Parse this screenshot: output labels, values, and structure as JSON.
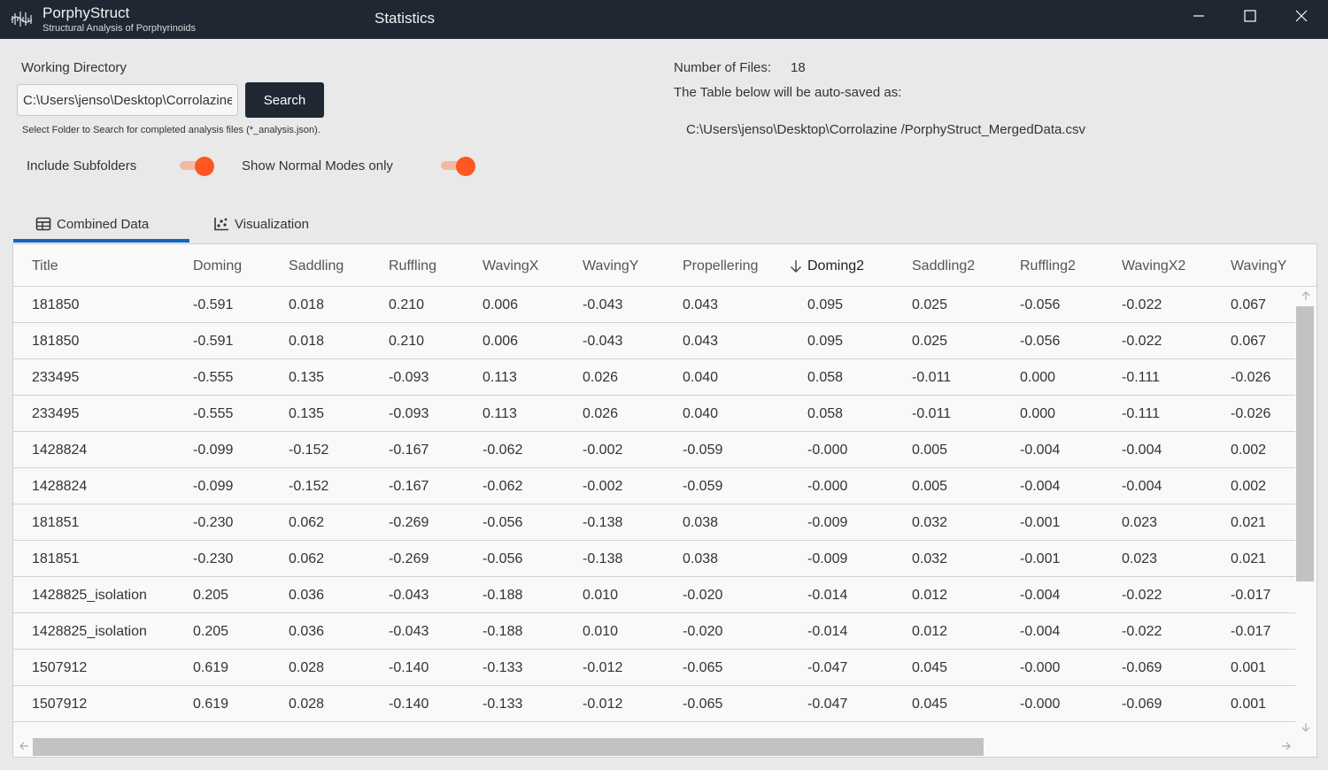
{
  "window": {
    "app_name": "PorphyStruct",
    "app_subtitle": "Structural Analysis of Porphyrinoids",
    "title": "Statistics"
  },
  "working_directory": {
    "label": "Working Directory",
    "value": "C:\\Users\\jenso\\Desktop\\Corrolazine",
    "search_label": "Search",
    "hint": "Select Folder to Search for completed analysis files (*_analysis.json)."
  },
  "info": {
    "files_label": "Number of Files:",
    "files_count": "18",
    "autosave_label": "The Table below will be auto-saved as:",
    "autosave_path": "C:\\Users\\jenso\\Desktop\\Corrolazine /PorphyStruct_MergedData.csv"
  },
  "options": {
    "include_subfolders_label": "Include Subfolders",
    "include_subfolders": true,
    "normal_modes_label": "Show Normal Modes only",
    "normal_modes": true
  },
  "tabs": [
    {
      "label": "Combined Data",
      "icon": "table-icon",
      "selected": true
    },
    {
      "label": "Visualization",
      "icon": "scatter-chart-icon",
      "selected": false
    }
  ],
  "table": {
    "sorted_column": "Doming2",
    "columns": [
      "Title",
      "Doming",
      "Saddling",
      "Ruffling",
      "WavingX",
      "WavingY",
      "Propellering",
      "Doming2",
      "Saddling2",
      "Ruffling2",
      "WavingX2",
      "WavingY"
    ],
    "rows": [
      [
        "181850",
        "-0.591",
        "0.018",
        "0.210",
        "0.006",
        "-0.043",
        "0.043",
        "0.095",
        "0.025",
        "-0.056",
        "-0.022",
        "0.067"
      ],
      [
        "181850",
        "-0.591",
        "0.018",
        "0.210",
        "0.006",
        "-0.043",
        "0.043",
        "0.095",
        "0.025",
        "-0.056",
        "-0.022",
        "0.067"
      ],
      [
        "233495",
        "-0.555",
        "0.135",
        "-0.093",
        "0.113",
        "0.026",
        "0.040",
        "0.058",
        "-0.011",
        "0.000",
        "-0.111",
        "-0.026"
      ],
      [
        "233495",
        "-0.555",
        "0.135",
        "-0.093",
        "0.113",
        "0.026",
        "0.040",
        "0.058",
        "-0.011",
        "0.000",
        "-0.111",
        "-0.026"
      ],
      [
        "1428824",
        "-0.099",
        "-0.152",
        "-0.167",
        "-0.062",
        "-0.002",
        "-0.059",
        "-0.000",
        "0.005",
        "-0.004",
        "-0.004",
        "0.002"
      ],
      [
        "1428824",
        "-0.099",
        "-0.152",
        "-0.167",
        "-0.062",
        "-0.002",
        "-0.059",
        "-0.000",
        "0.005",
        "-0.004",
        "-0.004",
        "0.002"
      ],
      [
        "181851",
        "-0.230",
        "0.062",
        "-0.269",
        "-0.056",
        "-0.138",
        "0.038",
        "-0.009",
        "0.032",
        "-0.001",
        "0.023",
        "0.021"
      ],
      [
        "181851",
        "-0.230",
        "0.062",
        "-0.269",
        "-0.056",
        "-0.138",
        "0.038",
        "-0.009",
        "0.032",
        "-0.001",
        "0.023",
        "0.021"
      ],
      [
        "1428825_isolation",
        "0.205",
        "0.036",
        "-0.043",
        "-0.188",
        "0.010",
        "-0.020",
        "-0.014",
        "0.012",
        "-0.004",
        "-0.022",
        "-0.017"
      ],
      [
        "1428825_isolation",
        "0.205",
        "0.036",
        "-0.043",
        "-0.188",
        "0.010",
        "-0.020",
        "-0.014",
        "0.012",
        "-0.004",
        "-0.022",
        "-0.017"
      ],
      [
        "1507912",
        "0.619",
        "0.028",
        "-0.140",
        "-0.133",
        "-0.012",
        "-0.065",
        "-0.047",
        "0.045",
        "-0.000",
        "-0.069",
        "0.001"
      ],
      [
        "1507912",
        "0.619",
        "0.028",
        "-0.140",
        "-0.133",
        "-0.012",
        "-0.065",
        "-0.047",
        "0.045",
        "-0.000",
        "-0.069",
        "0.001"
      ]
    ]
  }
}
